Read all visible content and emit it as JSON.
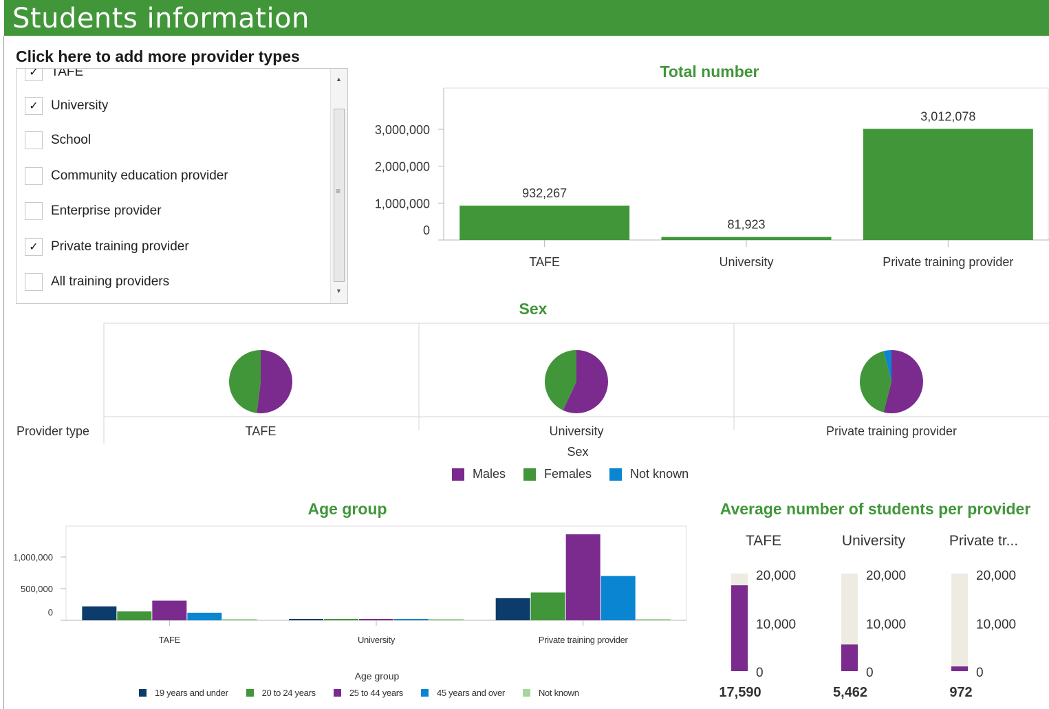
{
  "header": {
    "title": "Students information"
  },
  "provider_selector": {
    "heading": "Click here to add more provider types",
    "items": [
      {
        "label": "TAFE",
        "checked": true
      },
      {
        "label": "University",
        "checked": true
      },
      {
        "label": "School",
        "checked": false
      },
      {
        "label": "Community education provider",
        "checked": false
      },
      {
        "label": "Enterprise provider",
        "checked": false
      },
      {
        "label": "Private training provider",
        "checked": true
      },
      {
        "label": "All training providers",
        "checked": false
      }
    ],
    "scroll_up_glyph": "▲",
    "scroll_down_glyph": "▼",
    "scroll_grip_glyph": "≡",
    "check_glyph": "✓"
  },
  "total_number": {
    "title": "Total number",
    "y_ticks": [
      "3,000,000",
      "2,000,000",
      "1,000,000",
      "0"
    ]
  },
  "sex": {
    "title": "Sex",
    "row_label": "Provider type",
    "x_label": "Sex",
    "legend": [
      "Males",
      "Females",
      "Not known"
    ]
  },
  "age_group": {
    "title": "Age group",
    "x_label": "Age group",
    "y_ticks": [
      "1,000,000",
      "500,000",
      "0"
    ],
    "legend": [
      "19 years and under",
      "20 to 24 years",
      "25 to 44 years",
      "45 years and over",
      "Not known"
    ]
  },
  "average": {
    "title": "Average number of students per provider",
    "columns": [
      {
        "label": "TAFE",
        "value_label": "17,590",
        "value": 17590
      },
      {
        "label": "University",
        "value_label": "5,462",
        "value": 5462
      },
      {
        "label": "Private tr...",
        "value_label": "972",
        "value": 972
      }
    ],
    "gauge_max": 20000,
    "ticks": [
      "20,000",
      "10,000",
      "0"
    ]
  },
  "colors": {
    "brand_green": "#41963a",
    "males": "#7b2b8e",
    "females": "#41963a",
    "not_known": "#0a85d1",
    "age_19_under": "#0b3c6b",
    "age_20_24": "#41963a",
    "age_25_44": "#7b2b8e",
    "age_45_over": "#0a85d1",
    "age_not_known": "#a6d69a",
    "gauge_track": "#eeece2"
  },
  "chart_data": [
    {
      "type": "bar",
      "title": "Total number",
      "categories": [
        "TAFE",
        "University",
        "Private training provider"
      ],
      "values": [
        932267,
        81923,
        3012078
      ],
      "data_labels": [
        "932,267",
        "81,923",
        "3,012,078"
      ],
      "ylim": [
        0,
        3500000
      ],
      "grid": false
    },
    {
      "type": "pie",
      "title": "Sex",
      "categories": [
        "TAFE",
        "University",
        "Private training provider"
      ],
      "slice_labels": [
        "Males",
        "Females",
        "Not known"
      ],
      "series": [
        {
          "name": "TAFE",
          "values": [
            0.52,
            0.48,
            0.0
          ]
        },
        {
          "name": "University",
          "values": [
            0.57,
            0.43,
            0.0
          ]
        },
        {
          "name": "Private training provider",
          "values": [
            0.54,
            0.42,
            0.04
          ]
        }
      ],
      "legend_position": "bottom"
    },
    {
      "type": "bar",
      "title": "Age group",
      "xlabel": "Age group",
      "categories": [
        "TAFE",
        "University",
        "Private training provider"
      ],
      "series": [
        {
          "name": "19 years and under",
          "values": [
            220000,
            20000,
            350000
          ]
        },
        {
          "name": "20 to 24 years",
          "values": [
            140000,
            20000,
            440000
          ]
        },
        {
          "name": "25 to 44 years",
          "values": [
            310000,
            20000,
            1360000
          ]
        },
        {
          "name": "45 years and over",
          "values": [
            120000,
            20000,
            700000
          ]
        },
        {
          "name": "Not known",
          "values": [
            20000,
            20000,
            20000
          ]
        }
      ],
      "ylim": [
        0,
        1500000
      ],
      "grid": false,
      "legend_position": "bottom"
    }
  ]
}
